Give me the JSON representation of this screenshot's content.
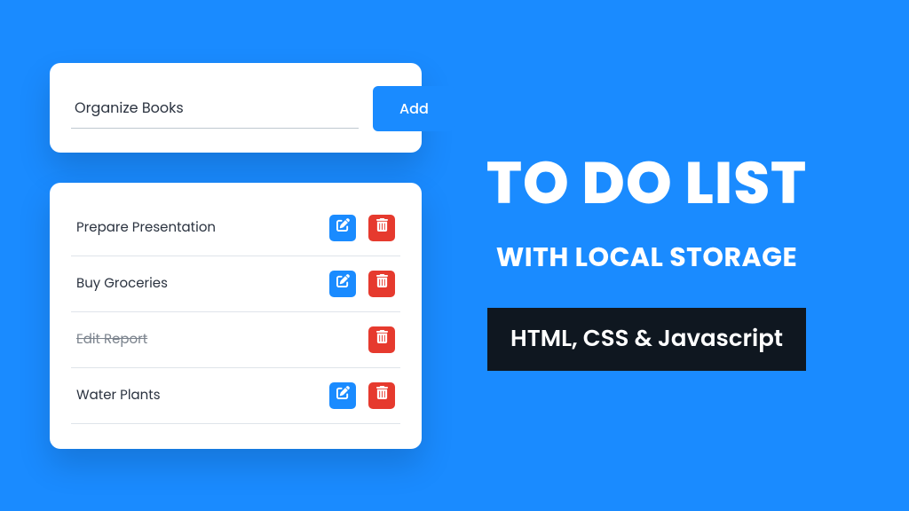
{
  "colors": {
    "accent": "#1a8bff",
    "danger": "#e63a2e",
    "badgeBg": "#0f1720"
  },
  "input": {
    "value": "Organize Books",
    "add_label": "Add"
  },
  "tasks": [
    {
      "label": "Prepare Presentation",
      "done": false,
      "editable": true
    },
    {
      "label": "Buy Groceries",
      "done": false,
      "editable": true
    },
    {
      "label": "Edit Report",
      "done": true,
      "editable": false
    },
    {
      "label": "Water Plants",
      "done": false,
      "editable": true
    }
  ],
  "headline": {
    "line1": "TO DO LIST",
    "line2": "WITH LOCAL STORAGE",
    "badge": "HTML, CSS & Javascript"
  }
}
